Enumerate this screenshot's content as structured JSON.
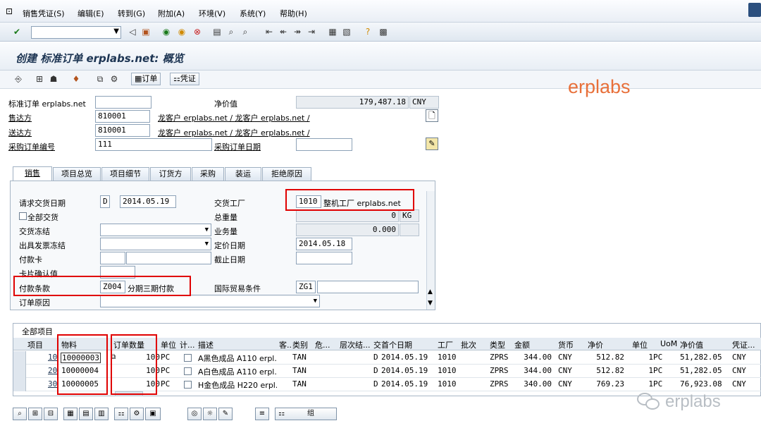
{
  "menu": {
    "items": [
      "销售凭证(S)",
      "编辑(E)",
      "转到(G)",
      "附加(A)",
      "环境(V)",
      "系统(Y)",
      "帮助(H)"
    ]
  },
  "toolbar": {
    "command_field": ""
  },
  "title": "创建 标准订单 erplabs.net: 概览",
  "app_toolbar": {
    "order_btn": "订单",
    "doc_btn": "凭证"
  },
  "header": {
    "order_label": "标准订单 erplabs.net",
    "order_value": "",
    "net_label": "净价值",
    "net_value": "179,487.18",
    "currency": "CNY",
    "soldto_label": "售达方",
    "soldto_value": "810001",
    "soldto_desc": "龙客户 erplabs.net / 龙客户 erplabs.net /",
    "shipto_label": "送达方",
    "shipto_value": "810001",
    "shipto_desc": "龙客户 erplabs.net / 龙客户 erplabs.net /",
    "po_label": "采购订单编号",
    "po_value": "111",
    "po_date_label": "采购订单日期",
    "po_date_value": ""
  },
  "watermark": "erplabs",
  "watermark2": "erplabs",
  "tabs": [
    "销售",
    "项目总览",
    "项目细节",
    "订货方",
    "采购",
    "装运",
    "拒绝原因"
  ],
  "sales_tab": {
    "req_date_label": "请求交货日期",
    "req_date_unit": "D",
    "req_date": "2014.05.19",
    "plant_label": "交货工厂",
    "plant": "1010",
    "plant_desc": "整机工厂 erplabs.net",
    "full_delivery": "全部交货",
    "weight_label": "总重量",
    "weight": "0",
    "weight_unit": "KG",
    "block_label": "交货冻结",
    "volume_label": "业务量",
    "volume": "0.000",
    "billing_block_label": "出具发票冻结",
    "pricing_date_label": "定价日期",
    "pricing_date": "2014.05.18",
    "card_label": "付款卡",
    "expiry_label": "截止日期",
    "card_verify_label": "卡片确认值",
    "payterm_label": "付款条款",
    "payterm": "Z004",
    "payterm_desc": "分期三期付款",
    "incoterm_label": "国际贸易条件",
    "incoterm": "ZG1",
    "reason_label": "订单原因"
  },
  "items_table": {
    "title": "全部项目",
    "columns": [
      "项目",
      "物料",
      "订单数量",
      "单位",
      "计...",
      "描述",
      "客...",
      "类别",
      "危...",
      "层次结...",
      "交",
      "首个日期",
      "工厂",
      "批次",
      "类型",
      "金额",
      "货币",
      "净价",
      "单位",
      "UoM",
      "净价值",
      "凭证..."
    ],
    "rows": [
      {
        "item": "10",
        "material": "10000003",
        "qty": "100",
        "unit": "PC",
        "desc": "A黑色成品 A110 erpl...",
        "cat": "TAN",
        "d": "D",
        "date": "2014.05.19",
        "plant": "1010",
        "type": "ZPRS",
        "amount": "344.00",
        "cur": "CNY",
        "net": "512.82",
        "per": "1",
        "uom": "PC",
        "netval": "51,282.05",
        "doccur": "CNY"
      },
      {
        "item": "20",
        "material": "10000004",
        "qty": "100",
        "unit": "PC",
        "desc": "A白色成品 A110 erpl...",
        "cat": "TAN",
        "d": "D",
        "date": "2014.05.19",
        "plant": "1010",
        "type": "ZPRS",
        "amount": "344.00",
        "cur": "CNY",
        "net": "512.82",
        "per": "1",
        "uom": "PC",
        "netval": "51,282.05",
        "doccur": "CNY"
      },
      {
        "item": "30",
        "material": "10000005",
        "qty": "100",
        "unit": "PC",
        "desc": "H金色成品 H220 erpl...",
        "cat": "TAN",
        "d": "D",
        "date": "2014.05.19",
        "plant": "1010",
        "type": "ZPRS",
        "amount": "340.00",
        "cur": "CNY",
        "net": "769.23",
        "per": "1",
        "uom": "PC",
        "netval": "76,923.08",
        "doccur": "CNY"
      }
    ]
  },
  "bottom_toolbar": {
    "group_btn": "组"
  },
  "colors": {
    "red_highlight": "#e00000",
    "watermark": "#e8703a"
  }
}
